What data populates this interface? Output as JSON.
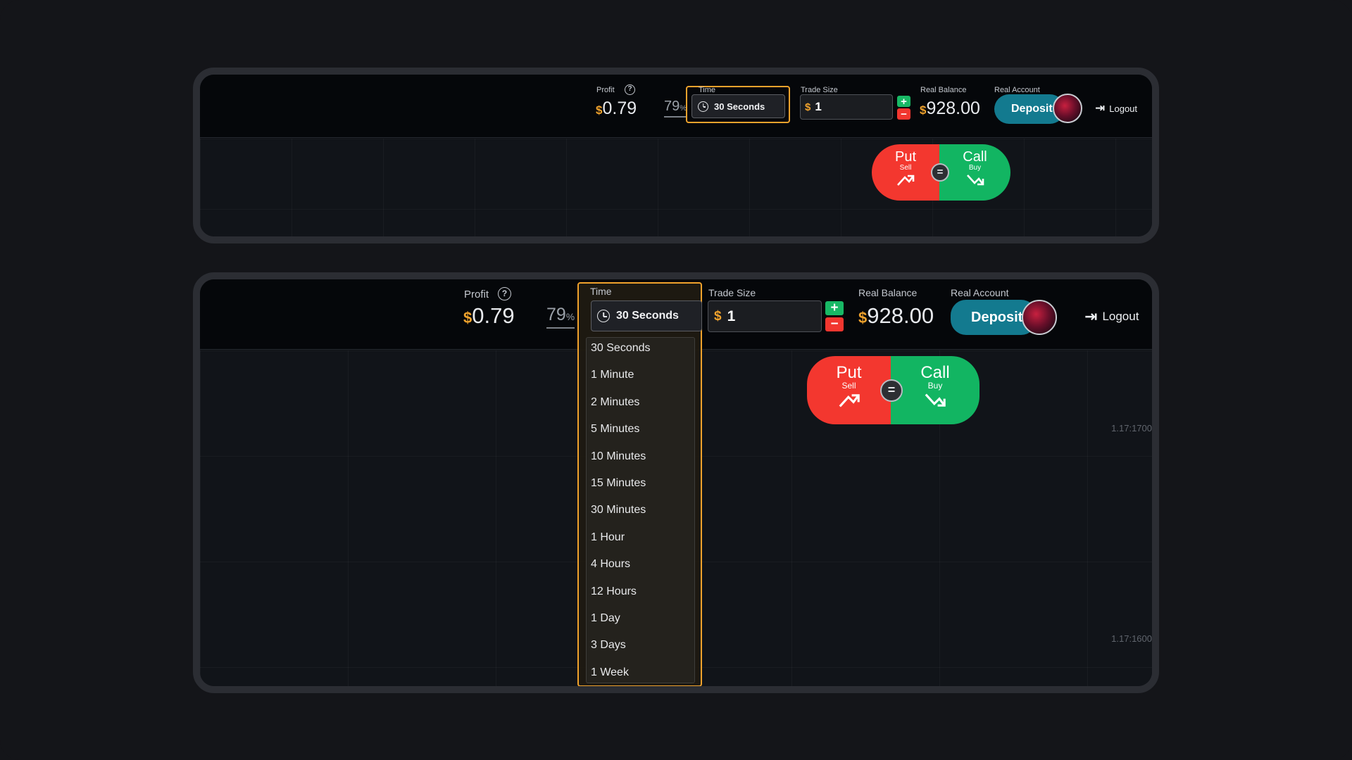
{
  "top_panel": {
    "profit_label": "Profit",
    "profit_help_icon": "?",
    "profit_currency": "$",
    "profit_value": "0.79",
    "profit_percent": "79",
    "percent_sign": "%",
    "time_label": "Time",
    "time_value": "30 Seconds",
    "trade_size_label": "Trade Size",
    "trade_currency": "$",
    "trade_value": "1",
    "plus": "+",
    "minus": "−",
    "balance_label": "Real Balance",
    "balance_currency": "$",
    "balance_value": "928.00",
    "account_label": "Real Account",
    "deposit_label": "Deposit",
    "logout_label": "Logout",
    "put_label": "Put",
    "put_sub": "Sell",
    "call_label": "Call",
    "call_sub": "Buy",
    "equal_icon": "="
  },
  "bottom_panel": {
    "profit_label": "Profit",
    "profit_help_icon": "?",
    "profit_currency": "$",
    "profit_value": "0.79",
    "profit_percent": "79",
    "percent_sign": "%",
    "time_label": "Time",
    "time_value": "30 Seconds",
    "trade_size_label": "Trade Size",
    "trade_currency": "$",
    "trade_value": "1",
    "plus": "+",
    "minus": "−",
    "balance_label": "Real Balance",
    "balance_currency": "$",
    "balance_value": "928.00",
    "account_label": "Real Account",
    "deposit_label": "Deposit",
    "logout_label": "Logout",
    "put_label": "Put",
    "put_sub": "Sell",
    "call_label": "Call",
    "call_sub": "Buy",
    "equal_icon": "=",
    "price_ticks": [
      "1.17:1700",
      "1.17:1600"
    ],
    "time_options": [
      "30 Seconds",
      "1 Minute",
      "2 Minutes",
      "5 Minutes",
      "10 Minutes",
      "15 Minutes",
      "30 Minutes",
      "1 Hour",
      "4 Hours",
      "12 Hours",
      "1 Day",
      "3 Days",
      "1 Week"
    ]
  },
  "colors": {
    "accent_orange": "#f0a22c",
    "put_red": "#f3372f",
    "call_green": "#12b562",
    "deposit_teal": "#137a8f"
  },
  "icons": [
    "help-icon",
    "clock-icon",
    "plus-icon",
    "minus-icon",
    "avatar",
    "logout-icon",
    "arrow-down-right-icon",
    "arrow-up-right-icon",
    "equal-icon"
  ]
}
